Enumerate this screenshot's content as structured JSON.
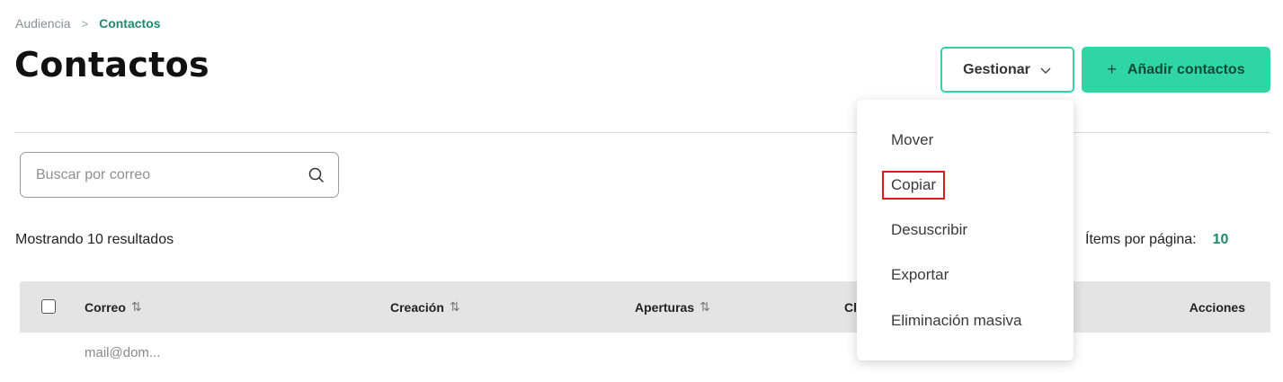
{
  "breadcrumb": {
    "parent": "Audiencia",
    "separator": ">",
    "current": "Contactos"
  },
  "page": {
    "title": "Contactos"
  },
  "toolbar": {
    "manage_label": "Gestionar",
    "add_label": "Añadir contactos",
    "add_icon": "plus-icon"
  },
  "search": {
    "placeholder": "Buscar por correo",
    "value": ""
  },
  "results": {
    "label": "Mostrando 10 resultados"
  },
  "pagination": {
    "per_page_label": "Ítems por página:",
    "per_page_value": "10"
  },
  "table": {
    "columns": [
      {
        "label": "Correo",
        "sortable": true
      },
      {
        "label": "Creación",
        "sortable": true
      },
      {
        "label": "Aperturas",
        "sortable": true
      },
      {
        "label": "Cl",
        "sortable": false
      },
      {
        "label": "Acciones",
        "sortable": false
      }
    ],
    "first_row_partial": "mail@dom..."
  },
  "manage_menu": {
    "open": true,
    "items": [
      {
        "label": "Mover"
      },
      {
        "label": "Copiar",
        "highlighted": true
      },
      {
        "label": "Desuscribir"
      },
      {
        "label": "Exportar"
      },
      {
        "label": "Eliminación masiva"
      }
    ]
  },
  "colors": {
    "accent": "#2fd6a3",
    "accent_text": "#1f8a6f",
    "highlight": "#e2191b"
  }
}
